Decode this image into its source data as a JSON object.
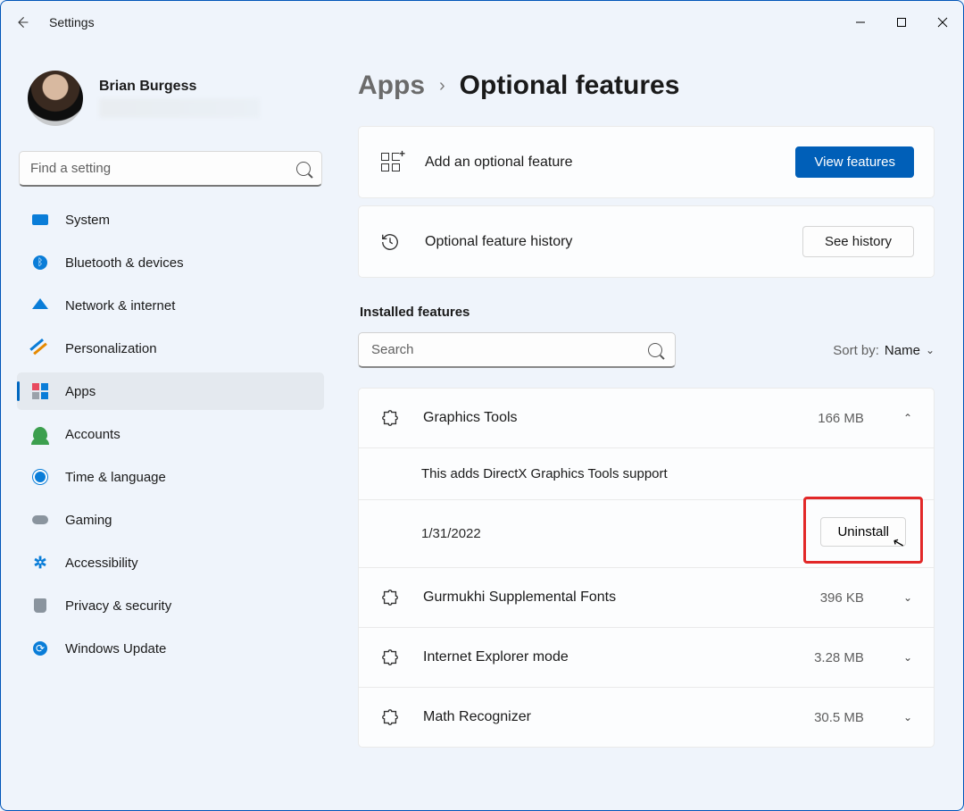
{
  "app_title": "Settings",
  "profile": {
    "name": "Brian Burgess"
  },
  "search_placeholder": "Find a setting",
  "nav": {
    "items": [
      {
        "label": "System"
      },
      {
        "label": "Bluetooth & devices"
      },
      {
        "label": "Network & internet"
      },
      {
        "label": "Personalization"
      },
      {
        "label": "Apps"
      },
      {
        "label": "Accounts"
      },
      {
        "label": "Time & language"
      },
      {
        "label": "Gaming"
      },
      {
        "label": "Accessibility"
      },
      {
        "label": "Privacy & security"
      },
      {
        "label": "Windows Update"
      }
    ]
  },
  "breadcrumb": {
    "parent": "Apps",
    "current": "Optional features"
  },
  "cards": {
    "add": {
      "label": "Add an optional feature",
      "button": "View features"
    },
    "history": {
      "label": "Optional feature history",
      "button": "See history"
    }
  },
  "installed": {
    "title": "Installed features",
    "search_placeholder": "Search",
    "sort_label": "Sort by:",
    "sort_value": "Name"
  },
  "features": [
    {
      "name": "Graphics Tools",
      "size": "166 MB",
      "expanded": true,
      "description": "This adds DirectX Graphics Tools support",
      "date": "1/31/2022",
      "uninstall": "Uninstall"
    },
    {
      "name": "Gurmukhi Supplemental Fonts",
      "size": "396 KB",
      "expanded": false
    },
    {
      "name": "Internet Explorer mode",
      "size": "3.28 MB",
      "expanded": false
    },
    {
      "name": "Math Recognizer",
      "size": "30.5 MB",
      "expanded": false
    }
  ]
}
